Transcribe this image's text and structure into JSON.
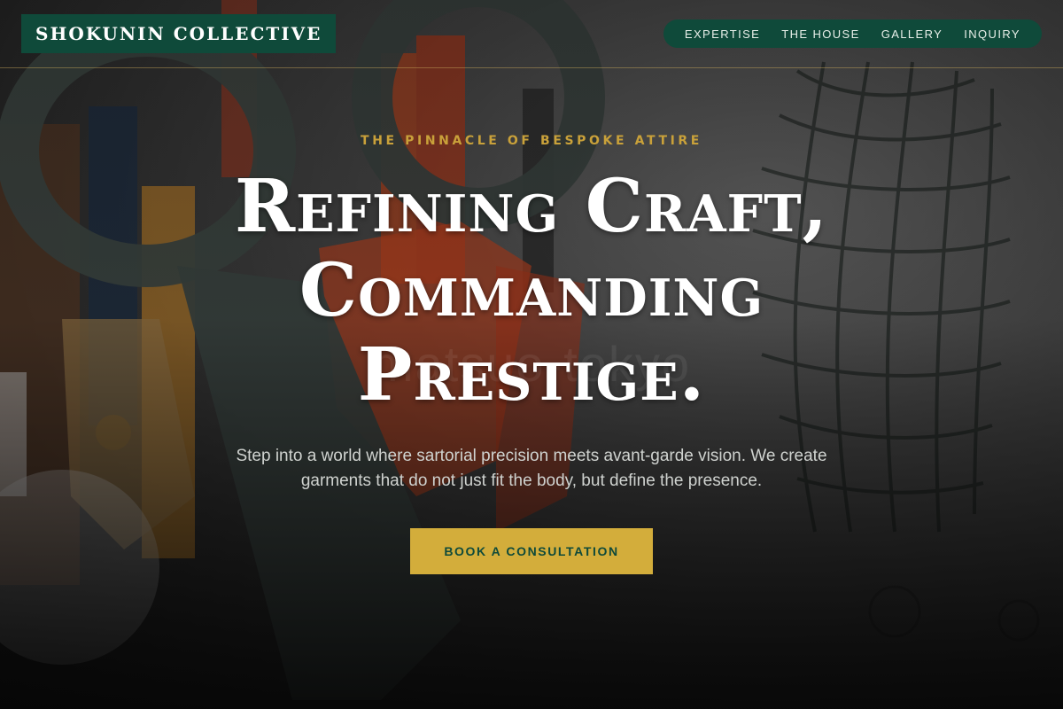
{
  "brand": {
    "name": "SHOKUNIN COLLECTIVE"
  },
  "nav": {
    "items": [
      {
        "label": "EXPERTISE"
      },
      {
        "label": "THE HOUSE"
      },
      {
        "label": "GALLERY"
      },
      {
        "label": "INQUIRY"
      }
    ]
  },
  "hero": {
    "eyebrow": "THE PINNACLE OF BESPOKE ATTIRE",
    "headline": [
      "Refining Craft,",
      "Commanding",
      "Prestige."
    ],
    "lead": "Step into a world where sartorial precision meets avant-garde vision. We create garments that do not just fit the body, but define the presence.",
    "cta_label": "BOOK A CONSULTATION",
    "watermark": "matsuo-tokyo"
  },
  "colors": {
    "brand_green": "#0f4a3a",
    "accent_gold": "#d3ad3b",
    "eyebrow_gold": "#c9a13a",
    "text_white": "#ffffff"
  }
}
